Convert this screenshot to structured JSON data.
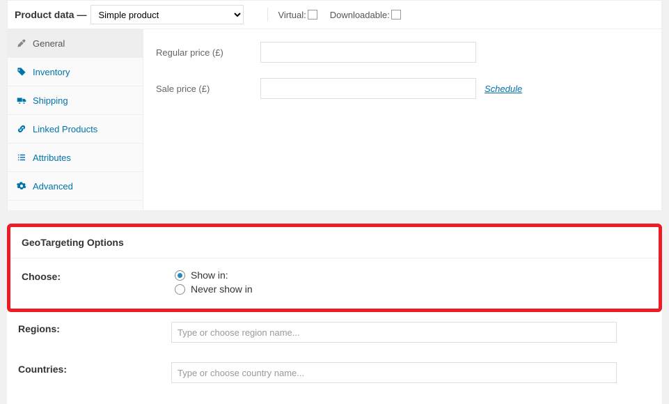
{
  "header": {
    "title": "Product data —",
    "product_type": "Simple product",
    "virtual_label": "Virtual:",
    "downloadable_label": "Downloadable:"
  },
  "tabs": {
    "general": "General",
    "inventory": "Inventory",
    "shipping": "Shipping",
    "linked": "Linked Products",
    "attributes": "Attributes",
    "advanced": "Advanced"
  },
  "pricing": {
    "regular_label": "Regular price (£)",
    "sale_label": "Sale price (£)",
    "regular_value": "",
    "sale_value": "",
    "schedule_label": "Schedule"
  },
  "geo": {
    "section_title": "GeoTargeting Options",
    "choose_label": "Choose:",
    "show_in_label": "Show in:",
    "never_show_label": "Never show in",
    "regions_label": "Regions:",
    "countries_label": "Countries:",
    "regions_placeholder": "Type or choose region name...",
    "countries_placeholder": "Type or choose country name..."
  }
}
